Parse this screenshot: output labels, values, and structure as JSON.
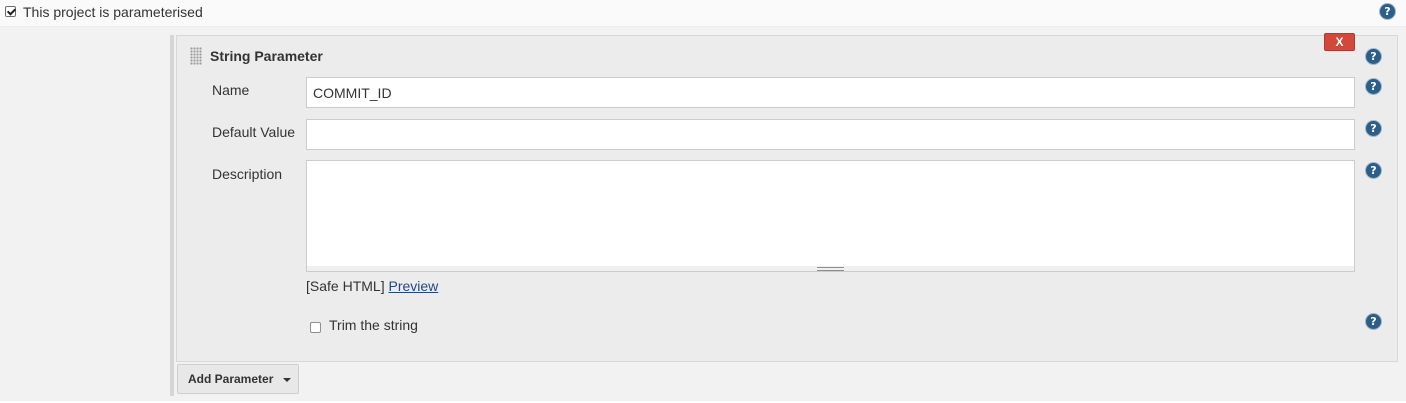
{
  "parameterised": {
    "label": "This project is parameterised",
    "checked": true
  },
  "parameter": {
    "title": "String Parameter",
    "delete_label": "X",
    "name_label": "Name",
    "name_value": "COMMIT_ID",
    "default_label": "Default Value",
    "default_value": "",
    "description_label": "Description",
    "description_value": "",
    "safe_html_text": "[Safe HTML]",
    "preview_label": "Preview",
    "trim_label": "Trim the string",
    "trim_checked": false
  },
  "add_parameter_label": "Add Parameter",
  "help_glyph": "?",
  "icons": [
    "checkbox-icon",
    "help-icon",
    "drag-handle-icon",
    "dropdown-caret-icon"
  ],
  "colors": {
    "delete_button": "#d24939",
    "help_icon": "#2c5e88",
    "link": "#204a87",
    "panel": "#ececec"
  }
}
